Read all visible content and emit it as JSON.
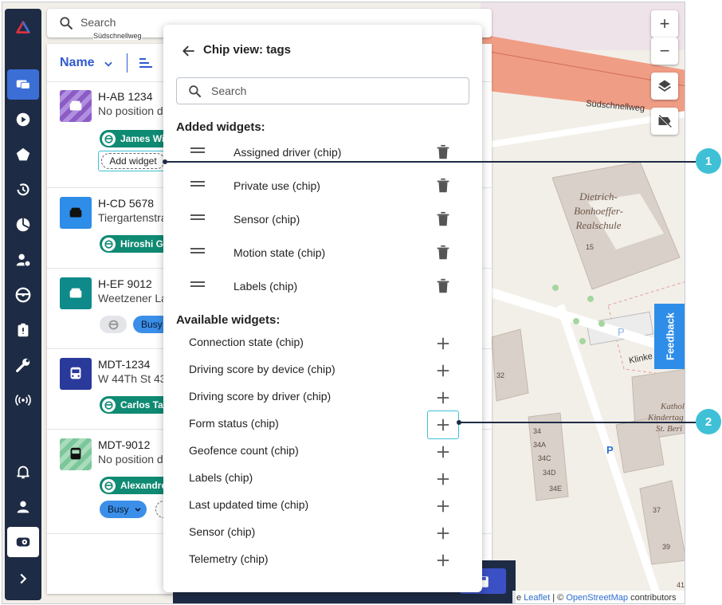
{
  "search": {
    "placeholder": "Search"
  },
  "map": {
    "street_1": "Südschnellweg",
    "street_2": "Südschnellweg",
    "school": [
      "Dietrich-",
      "Bonhoeffer-",
      "Realschule"
    ],
    "kita": [
      "Kathol",
      "Kindertag",
      "St. Beri"
    ],
    "street_3": "Klinke",
    "house_numbers": [
      "15",
      "32",
      "34",
      "34A",
      "34C",
      "34D",
      "34E",
      "37",
      "39",
      "41"
    ],
    "parking": "P"
  },
  "map_controls": {
    "zoom_in": "+",
    "zoom_out": "−"
  },
  "feedback_label": "Feedback",
  "attribution": {
    "prefix": "e",
    "leaflet": "Leaflet",
    "sep": " | © ",
    "osm": "OpenStreetMap",
    "suffix": " contributors"
  },
  "list": {
    "sort_label": "Name",
    "vehicles": [
      {
        "name": "H-AB 1234",
        "address": "No position d",
        "driver": "James Wi",
        "add_widget": "Add widget"
      },
      {
        "name": "H-CD 5678",
        "address": "Tiergartenstra",
        "driver": "Hiroshi Ga"
      },
      {
        "name": "H-EF 9012",
        "address": "Weetzener La",
        "status": "Busy"
      },
      {
        "name": "MDT-1234",
        "address": "W 44Th St 43",
        "driver": "Carlos Tar"
      },
      {
        "name": "MDT-9012",
        "address": "No position d",
        "driver": "Alexandre",
        "status": "Busy"
      }
    ]
  },
  "panel": {
    "title": "Chip view: tags",
    "search_placeholder": "Search",
    "added_heading": "Added widgets:",
    "added": [
      "Assigned driver (chip)",
      "Private use (chip)",
      "Sensor (chip)",
      "Motion state (chip)",
      "Labels (chip)"
    ],
    "available_heading": "Available widgets:",
    "available": [
      "Connection state (chip)",
      "Driving score by device (chip)",
      "Driving score by driver (chip)",
      "Form status (chip)",
      "Geofence count (chip)",
      "Labels (chip)",
      "Last updated time (chip)",
      "Sensor (chip)",
      "Telemetry (chip)"
    ]
  },
  "callouts": [
    "1",
    "2"
  ],
  "colors": {
    "sidebar": "#1e2b45",
    "active": "#3b6fd6",
    "chip_green": "#0f8a73",
    "accent_cyan": "#3fc0d6",
    "feedback": "#2e8de8"
  }
}
